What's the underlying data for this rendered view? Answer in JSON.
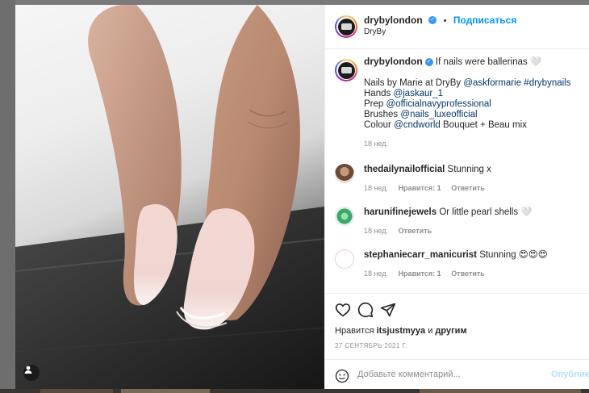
{
  "post": {
    "author": "drybylondon",
    "follow_separator": "•",
    "follow_label": "Подписаться",
    "location": "DryBy"
  },
  "caption": {
    "author": "drybylondon",
    "first_line": "If nails were ballerinas 🤍",
    "line1_prefix": "Nails by Marie at DryBy",
    "line1_mention": "@askformarie",
    "line1_tag": "#drybynails",
    "line2_prefix": "Hands",
    "line2_mention": "@jaskaur_1",
    "line3_prefix": "Prep",
    "line3_mention": "@officialnavyprofessional",
    "line4_prefix": "Brushes",
    "line4_mention": "@nails_luxeofficial",
    "line5_prefix": "Colour",
    "line5_mention": "@cndworld",
    "line5_suffix": "Bouquet + Beau mix",
    "time": "18 нед."
  },
  "comments": [
    {
      "author": "thedailynailofficial",
      "text": "Stunning x",
      "time": "18 нед.",
      "likes": "Нравится: 1",
      "reply": "Ответить"
    },
    {
      "author": "harunifinejewels",
      "text": "Or little pearl shells 🤍",
      "time": "18 нед.",
      "likes": "",
      "reply": "Ответить"
    },
    {
      "author": "stephaniecarr_manicurist",
      "text": "Stunning 😍😍😍",
      "time": "18 нед.",
      "likes": "Нравится: 1",
      "reply": "Ответить"
    }
  ],
  "likes_line": {
    "prefix": "Нравится",
    "user": "itsjustmyya",
    "conj": "и",
    "others": "другим"
  },
  "date": "27 СЕНТЯБРЬ 2021 Г.",
  "add_comment": {
    "placeholder": "Добавьте комментарий...",
    "publish": "Опублико"
  },
  "icons": {
    "like": "heart-icon",
    "comment": "comment-icon",
    "share": "share-icon",
    "emoji": "emoji-icon",
    "user_tag": "user-tag-icon",
    "verified": "verified-badge-icon"
  },
  "colors": {
    "link": "#00376b",
    "follow": "#0095f6",
    "verified": "#3897f0",
    "muted": "#8e8e8e"
  }
}
